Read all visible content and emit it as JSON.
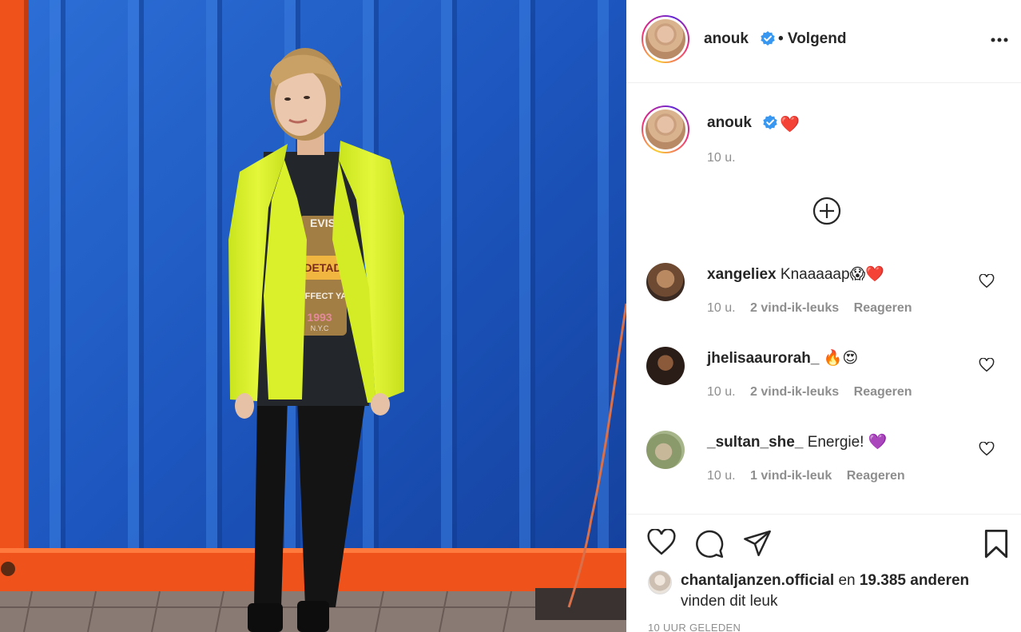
{
  "post": {
    "author": "anouk",
    "follow_label": "• Volgend",
    "caption_emoji": "❤️",
    "caption_time": "10 u.",
    "photo_shirt_text": [
      "EVIS",
      "DETAD",
      "AFFECT YA",
      "1993",
      "N.Y.C"
    ]
  },
  "comments": [
    {
      "user": "xangeliex",
      "text": "Knaaaaap😱❤️",
      "time": "10 u.",
      "likes": "2 vind-ik-leuks",
      "reply": "Reageren"
    },
    {
      "user": "jhelisaaurorah_",
      "text": "🔥😍",
      "time": "10 u.",
      "likes": "2 vind-ik-leuks",
      "reply": "Reageren"
    },
    {
      "user": "_sultan_she_",
      "text": "Energie! 💜",
      "time": "10 u.",
      "likes": "1 vind-ik-leuk",
      "reply": "Reageren"
    }
  ],
  "likes": {
    "first_user": "chantaljanzen.official",
    "connector": "en",
    "others": "19.385 anderen",
    "suffix": "vinden dit leuk"
  },
  "timestamp": "10 UUR GELEDEN",
  "icons": {
    "verified": "verified-badge-icon",
    "more": "more-options-icon",
    "load_more": "plus-circle-icon",
    "like": "heart-icon",
    "comment": "comment-icon",
    "share": "send-icon",
    "save": "bookmark-icon"
  },
  "colors": {
    "verified": "#3897f0",
    "text": "#262626",
    "muted": "#8e8e8e",
    "photo_wall": "#1b4fb0",
    "container_frame": "#f0521c",
    "jacket": "#dcf22a"
  }
}
